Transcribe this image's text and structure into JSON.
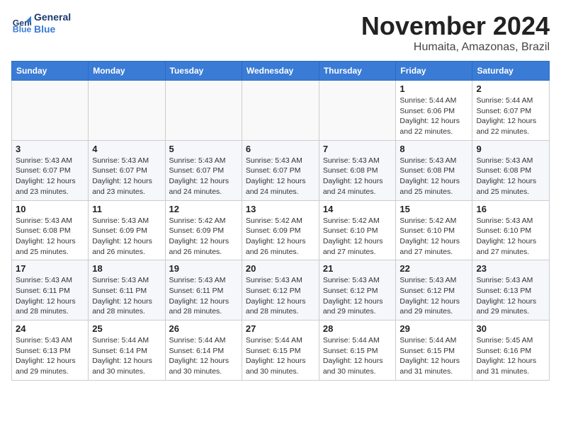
{
  "logo": {
    "line1": "General",
    "line2": "Blue"
  },
  "title": "November 2024",
  "subtitle": "Humaita, Amazonas, Brazil",
  "days_of_week": [
    "Sunday",
    "Monday",
    "Tuesday",
    "Wednesday",
    "Thursday",
    "Friday",
    "Saturday"
  ],
  "weeks": [
    [
      {
        "day": "",
        "info": ""
      },
      {
        "day": "",
        "info": ""
      },
      {
        "day": "",
        "info": ""
      },
      {
        "day": "",
        "info": ""
      },
      {
        "day": "",
        "info": ""
      },
      {
        "day": "1",
        "info": "Sunrise: 5:44 AM\nSunset: 6:06 PM\nDaylight: 12 hours and 22 minutes."
      },
      {
        "day": "2",
        "info": "Sunrise: 5:44 AM\nSunset: 6:07 PM\nDaylight: 12 hours and 22 minutes."
      }
    ],
    [
      {
        "day": "3",
        "info": "Sunrise: 5:43 AM\nSunset: 6:07 PM\nDaylight: 12 hours and 23 minutes."
      },
      {
        "day": "4",
        "info": "Sunrise: 5:43 AM\nSunset: 6:07 PM\nDaylight: 12 hours and 23 minutes."
      },
      {
        "day": "5",
        "info": "Sunrise: 5:43 AM\nSunset: 6:07 PM\nDaylight: 12 hours and 24 minutes."
      },
      {
        "day": "6",
        "info": "Sunrise: 5:43 AM\nSunset: 6:07 PM\nDaylight: 12 hours and 24 minutes."
      },
      {
        "day": "7",
        "info": "Sunrise: 5:43 AM\nSunset: 6:08 PM\nDaylight: 12 hours and 24 minutes."
      },
      {
        "day": "8",
        "info": "Sunrise: 5:43 AM\nSunset: 6:08 PM\nDaylight: 12 hours and 25 minutes."
      },
      {
        "day": "9",
        "info": "Sunrise: 5:43 AM\nSunset: 6:08 PM\nDaylight: 12 hours and 25 minutes."
      }
    ],
    [
      {
        "day": "10",
        "info": "Sunrise: 5:43 AM\nSunset: 6:08 PM\nDaylight: 12 hours and 25 minutes."
      },
      {
        "day": "11",
        "info": "Sunrise: 5:43 AM\nSunset: 6:09 PM\nDaylight: 12 hours and 26 minutes."
      },
      {
        "day": "12",
        "info": "Sunrise: 5:42 AM\nSunset: 6:09 PM\nDaylight: 12 hours and 26 minutes."
      },
      {
        "day": "13",
        "info": "Sunrise: 5:42 AM\nSunset: 6:09 PM\nDaylight: 12 hours and 26 minutes."
      },
      {
        "day": "14",
        "info": "Sunrise: 5:42 AM\nSunset: 6:10 PM\nDaylight: 12 hours and 27 minutes."
      },
      {
        "day": "15",
        "info": "Sunrise: 5:42 AM\nSunset: 6:10 PM\nDaylight: 12 hours and 27 minutes."
      },
      {
        "day": "16",
        "info": "Sunrise: 5:43 AM\nSunset: 6:10 PM\nDaylight: 12 hours and 27 minutes."
      }
    ],
    [
      {
        "day": "17",
        "info": "Sunrise: 5:43 AM\nSunset: 6:11 PM\nDaylight: 12 hours and 28 minutes."
      },
      {
        "day": "18",
        "info": "Sunrise: 5:43 AM\nSunset: 6:11 PM\nDaylight: 12 hours and 28 minutes."
      },
      {
        "day": "19",
        "info": "Sunrise: 5:43 AM\nSunset: 6:11 PM\nDaylight: 12 hours and 28 minutes."
      },
      {
        "day": "20",
        "info": "Sunrise: 5:43 AM\nSunset: 6:12 PM\nDaylight: 12 hours and 28 minutes."
      },
      {
        "day": "21",
        "info": "Sunrise: 5:43 AM\nSunset: 6:12 PM\nDaylight: 12 hours and 29 minutes."
      },
      {
        "day": "22",
        "info": "Sunrise: 5:43 AM\nSunset: 6:12 PM\nDaylight: 12 hours and 29 minutes."
      },
      {
        "day": "23",
        "info": "Sunrise: 5:43 AM\nSunset: 6:13 PM\nDaylight: 12 hours and 29 minutes."
      }
    ],
    [
      {
        "day": "24",
        "info": "Sunrise: 5:43 AM\nSunset: 6:13 PM\nDaylight: 12 hours and 29 minutes."
      },
      {
        "day": "25",
        "info": "Sunrise: 5:44 AM\nSunset: 6:14 PM\nDaylight: 12 hours and 30 minutes."
      },
      {
        "day": "26",
        "info": "Sunrise: 5:44 AM\nSunset: 6:14 PM\nDaylight: 12 hours and 30 minutes."
      },
      {
        "day": "27",
        "info": "Sunrise: 5:44 AM\nSunset: 6:15 PM\nDaylight: 12 hours and 30 minutes."
      },
      {
        "day": "28",
        "info": "Sunrise: 5:44 AM\nSunset: 6:15 PM\nDaylight: 12 hours and 30 minutes."
      },
      {
        "day": "29",
        "info": "Sunrise: 5:44 AM\nSunset: 6:15 PM\nDaylight: 12 hours and 31 minutes."
      },
      {
        "day": "30",
        "info": "Sunrise: 5:45 AM\nSunset: 6:16 PM\nDaylight: 12 hours and 31 minutes."
      }
    ]
  ]
}
